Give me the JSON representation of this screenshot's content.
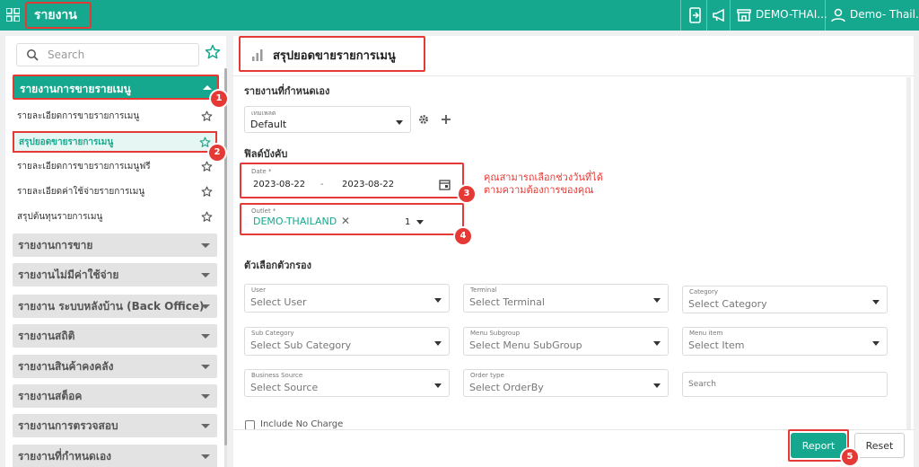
{
  "topbar": {
    "title": "รายงาน",
    "store_name": "DEMO-THAI...",
    "user_name": "Demo- Thail..."
  },
  "sidebar": {
    "search_placeholder": "Search",
    "active_group": "รายงานการขายรายเมนู",
    "sub_items": [
      {
        "label": "รายละเอียดการขายรายการเมนู",
        "active": false
      },
      {
        "label": "สรุปยอดขายรายการเมนู",
        "active": true
      },
      {
        "label": "รายละเอียดการขายรายการเมนูฟรี",
        "active": false
      },
      {
        "label": "รายละเอียดค่าใช้จ่ายรายการเมนู",
        "active": false
      },
      {
        "label": "สรุปต้นทุนรายการเมนู",
        "active": false
      }
    ],
    "groups": [
      "รายงานการขาย",
      "รายงานไม่มีค่าใช้จ่าย",
      "รายงาน ระบบหลังบ้าน (Back Office)",
      "รายงานสถิติ",
      "รายงานสินค้าคงคลัง",
      "รายงานสต็อค",
      "รายงานการตรวจสอบ",
      "รายงานที่กำหนดเอง"
    ]
  },
  "badges": [
    "1",
    "2",
    "3",
    "4",
    "5"
  ],
  "main": {
    "page_title": "สรุปยอดขายรายการเมนู",
    "custom_section": "รายงานที่กำหนดเอง",
    "template_label": "เทมเพลต",
    "template_value": "Default",
    "required_section": "ฟิลด์บังคับ",
    "date_label": "Date *",
    "date_from": "2023-08-22",
    "date_sep": "-",
    "date_to": "2023-08-22",
    "outlet_label": "Outlet *",
    "outlet_chip": "DEMO-THAILAND",
    "outlet_count": "1",
    "note_line1": "คุณสามารถเลือกช่วงวันที่ได้",
    "note_line2": "ตามความต้องการของคุณ",
    "filter_section": "ตัวเลือกตัวกรอง",
    "filters": [
      {
        "label": "User",
        "value": "Select User"
      },
      {
        "label": "Terminal",
        "value": "Select Terminal"
      },
      {
        "label": "Category",
        "value": "Select Category"
      },
      {
        "label": "Sub Category",
        "value": "Select Sub Category"
      },
      {
        "label": "Menu Subgroup",
        "value": "Select Menu SubGroup"
      },
      {
        "label": "Menu item",
        "value": "Select Item"
      },
      {
        "label": "Business Source",
        "value": "Select Source"
      },
      {
        "label": "Order type",
        "value": "Select OrderBy"
      }
    ],
    "search_placeholder": "Search",
    "include_no_charge": "Include No Charge",
    "report_button": "Report",
    "reset_button": "Reset"
  },
  "colors": {
    "accent": "#16a88e",
    "annotation": "#e53935"
  }
}
